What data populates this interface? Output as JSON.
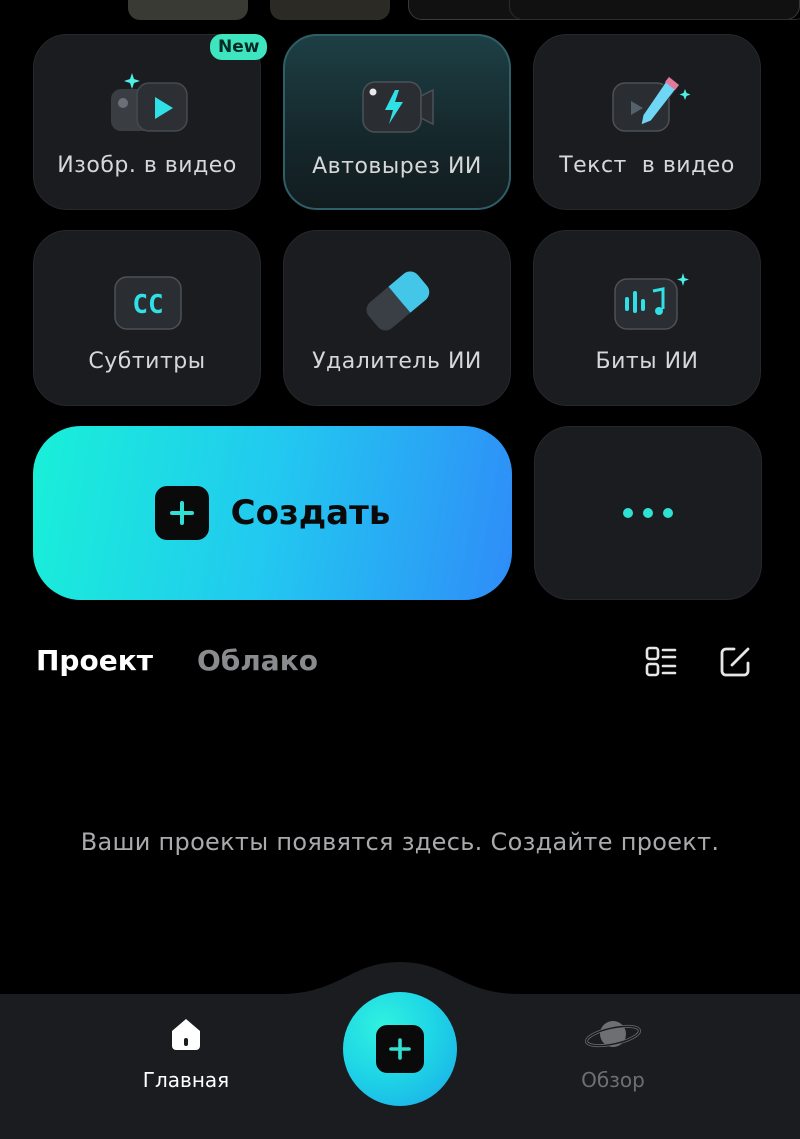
{
  "tools": [
    {
      "label": "Изобр. в видео",
      "icon": "image-to-video-icon",
      "badge": "New"
    },
    {
      "label": "Автовырез ИИ",
      "icon": "ai-cutout-icon",
      "active": true
    },
    {
      "label": "Текст  в видео",
      "icon": "text-to-video-icon"
    },
    {
      "label": "Субтитры",
      "icon": "captions-icon"
    },
    {
      "label": "Удалитель ИИ",
      "icon": "eraser-icon"
    },
    {
      "label": "Биты ИИ",
      "icon": "ai-beats-icon"
    }
  ],
  "create": {
    "label": "Создать"
  },
  "tabs": [
    {
      "label": "Проект",
      "active": true
    },
    {
      "label": "Облако",
      "active": false
    }
  ],
  "empty_message": "Ваши проекты появятся здесь. Создайте проект.",
  "nav": {
    "home_label": "Главная",
    "explore_label": "Обзор"
  },
  "colors": {
    "accent": "#2fe0d4",
    "background": "#000000",
    "tile": "#1b1c1f"
  }
}
